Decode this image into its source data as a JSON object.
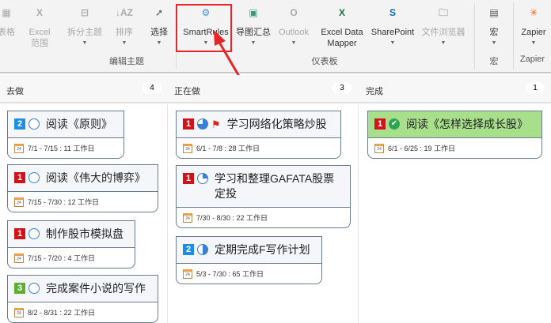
{
  "ribbon": {
    "buttons": [
      {
        "id": "table",
        "label": "表格",
        "icon": "table-icon",
        "disabled": true
      },
      {
        "id": "excel-range",
        "label": "Excel\n范围",
        "icon": "excel-icon",
        "disabled": true
      },
      {
        "id": "split-topic",
        "label": "拆分主题",
        "icon": "split-icon",
        "disabled": true,
        "dropdown": true
      },
      {
        "id": "sort",
        "label": "排序",
        "icon": "sort-az-icon",
        "disabled": true,
        "dropdown": true
      },
      {
        "id": "select",
        "label": "选择",
        "icon": "cursor-icon",
        "disabled": false,
        "dropdown": true
      },
      {
        "id": "smartrules",
        "label": "SmartRules",
        "icon": "smartrules-gear-head-icon",
        "disabled": false,
        "dropdown": true
      },
      {
        "id": "map-rollup",
        "label": "导图汇总",
        "icon": "map-rollup-icon",
        "disabled": false,
        "dropdown": true
      },
      {
        "id": "outlook",
        "label": "Outlook",
        "icon": "outlook-icon",
        "disabled": true,
        "dropdown": true
      },
      {
        "id": "excel-data-mapper",
        "label": "Excel Data\nMapper",
        "icon": "excel-icon",
        "disabled": false
      },
      {
        "id": "sharepoint",
        "label": "SharePoint",
        "icon": "sharepoint-icon",
        "disabled": false,
        "dropdown": true
      },
      {
        "id": "file-browser",
        "label": "文件浏览器",
        "icon": "folder-gear-icon",
        "disabled": true,
        "dropdown": true
      },
      {
        "id": "macro",
        "label": "宏",
        "icon": "macro-icon",
        "disabled": false,
        "dropdown": true
      },
      {
        "id": "zapier",
        "label": "Zapier",
        "icon": "zapier-icon",
        "disabled": false,
        "dropdown": true
      }
    ],
    "groups": {
      "edit": "编辑主题",
      "dashboard": "仪表板",
      "macro": "宏",
      "zapier": "Zapier"
    }
  },
  "columns": [
    {
      "title": "去做",
      "count": "4",
      "cards": [
        {
          "priority": "2",
          "progress": 0,
          "title": "阅读《原则》",
          "date": "7/1 - 7/15 : 11 工作日"
        },
        {
          "priority": "1",
          "progress": 0,
          "title": "阅读《伟大的博弈》",
          "date": "7/15 - 7/30 : 12 工作日"
        },
        {
          "priority": "1",
          "progress": 0,
          "title": "制作股市模拟盘",
          "date": "7/15 - 7/20 : 4 工作日"
        },
        {
          "priority": "3",
          "progress": 0,
          "title": "完成案件小说的写作",
          "date": "8/2 - 8/31 : 22 工作日"
        }
      ]
    },
    {
      "title": "正在做",
      "count": "3",
      "cards": [
        {
          "priority": "1",
          "progress": 75,
          "flag": true,
          "title": "学习网络化策略炒股",
          "date": "6/1 - 7/8 : 28 工作日"
        },
        {
          "priority": "1",
          "progress": 25,
          "title": "学习和整理GAFATA股票定投",
          "date": "7/30 - 8/30 : 22 工作日"
        },
        {
          "priority": "2",
          "progress": 50,
          "title": "定期完成F写作计划",
          "date": "5/3 - 7/30 : 65 工作日"
        }
      ]
    },
    {
      "title": "完成",
      "count": "1",
      "cards": [
        {
          "priority": "1",
          "progress": 100,
          "done": true,
          "title": "阅读《怎样选择成长股》",
          "date": "6/1 - 6/25 : 19 工作日"
        }
      ]
    }
  ],
  "calendar_icon_text": "24",
  "colors": {
    "priority1": "#d0121b",
    "priority2": "#1e8fe0",
    "priority3": "#5cb030",
    "done_bg": "#a7df8b",
    "highlight": "#e8262a"
  }
}
